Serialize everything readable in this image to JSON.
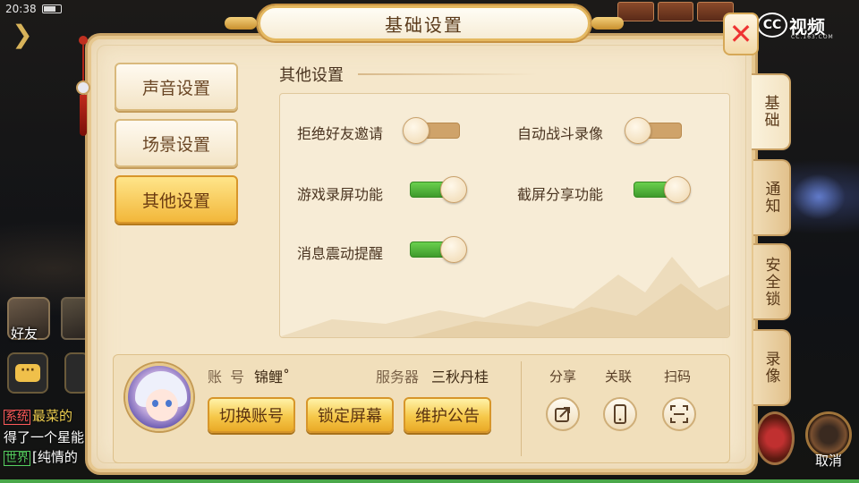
{
  "status_bar": {
    "time": "20:38"
  },
  "hud": {
    "friend_label": "好友",
    "chat_icon_glyph": "···",
    "chat_lines": [
      {
        "tag": "系统",
        "text": "最菜的"
      },
      {
        "tag": "",
        "text": "得了一个星能"
      },
      {
        "tag": "世界",
        "text": "[纯情的"
      }
    ],
    "cancel_label": "取消",
    "brand_name": "视频",
    "brand_circle": "CC",
    "brand_sub": "CC.163.COM"
  },
  "dialog": {
    "title": "基础设置",
    "close_glyph": "✕"
  },
  "menu": {
    "items": [
      {
        "label": "声音设置",
        "active": false
      },
      {
        "label": "场景设置",
        "active": false
      },
      {
        "label": "其他设置",
        "active": true
      }
    ]
  },
  "section": {
    "title": "其他设置",
    "options": [
      {
        "label": "拒绝好友邀请",
        "on": false
      },
      {
        "label": "自动战斗录像",
        "on": false
      },
      {
        "label": "游戏录屏功能",
        "on": true
      },
      {
        "label": "截屏分享功能",
        "on": true
      },
      {
        "label": "消息震动提醒",
        "on": true
      }
    ]
  },
  "account": {
    "account_label": "账 号",
    "account_name": "锦鲤˚",
    "server_label": "服务器",
    "server_name": "三秋丹桂",
    "buttons": [
      "切换账号",
      "锁定屏幕",
      "维护公告"
    ],
    "share": [
      {
        "label": "分享",
        "icon": "share-arrow-icon"
      },
      {
        "label": "关联",
        "icon": "phone-icon"
      },
      {
        "label": "扫码",
        "icon": "scan-qr-icon"
      }
    ]
  },
  "tabs": [
    {
      "label": "基础",
      "active": true
    },
    {
      "label": "通知",
      "active": false
    },
    {
      "label": "安全锁",
      "active": false
    },
    {
      "label": "录像",
      "active": false
    }
  ],
  "colors": {
    "toggle_on": "#4fb33a",
    "toggle_off": "#cfa36a",
    "active_menu": "#f2b73a",
    "close_x": "#e33333"
  }
}
